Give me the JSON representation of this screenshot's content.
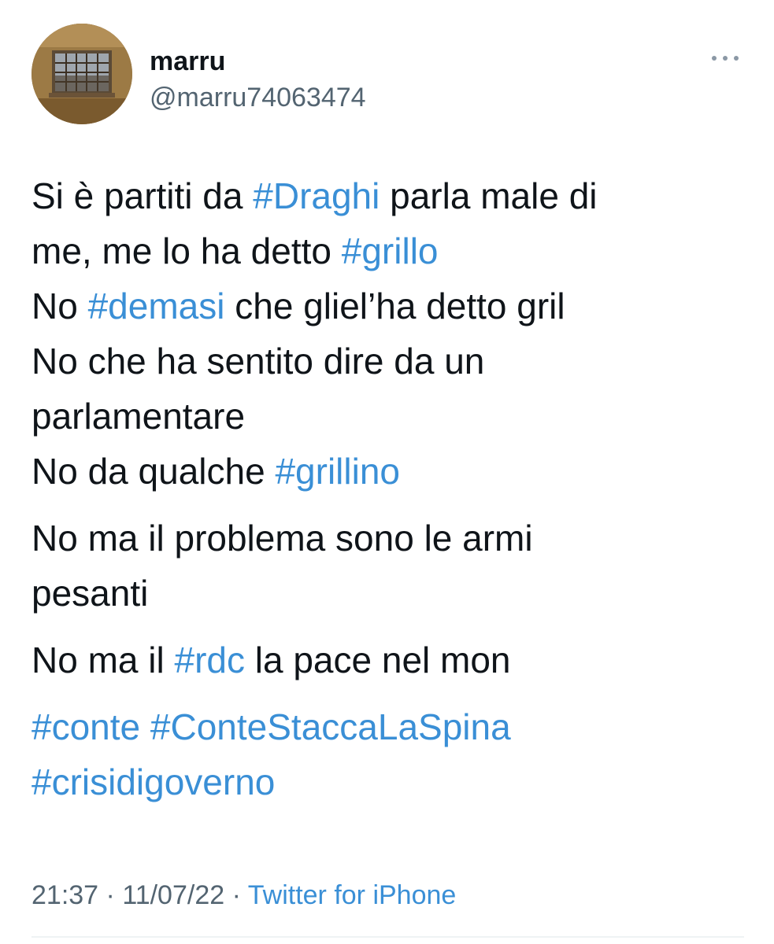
{
  "user": {
    "display_name": "marru",
    "handle": "@marru74063474",
    "avatar_icon": "profile-photo-window"
  },
  "more_icon": "ellipsis-horizontal-icon",
  "tweet": {
    "lines": [
      [
        "Si è partiti da ",
        "#Draghi",
        " parla male di"
      ],
      [
        "me, me lo ha detto ",
        "#grillo"
      ],
      [
        "No ",
        "#demasi",
        " che gliel’ha detto gril"
      ],
      [
        "No che ha sentito dire da un"
      ],
      [
        "parlamentare"
      ],
      [
        "No da qualche ",
        "#grillino"
      ],
      [
        "No ma il problema sono le armi"
      ],
      [
        "pesanti"
      ],
      [
        "No ma il ",
        "#rdc",
        " la pace nel mon"
      ],
      [
        "#conte",
        " ",
        "#ConteStaccaLaSpina"
      ],
      [
        "#crisidigoverno"
      ]
    ],
    "time": "21:37",
    "sep1": " · ",
    "date": "11/07/22",
    "sep2": " · ",
    "source": "Twitter for iPhone"
  },
  "colors": {
    "hashtag": "#3a8fd6",
    "text": "#0f1419",
    "secondary": "#536471"
  }
}
